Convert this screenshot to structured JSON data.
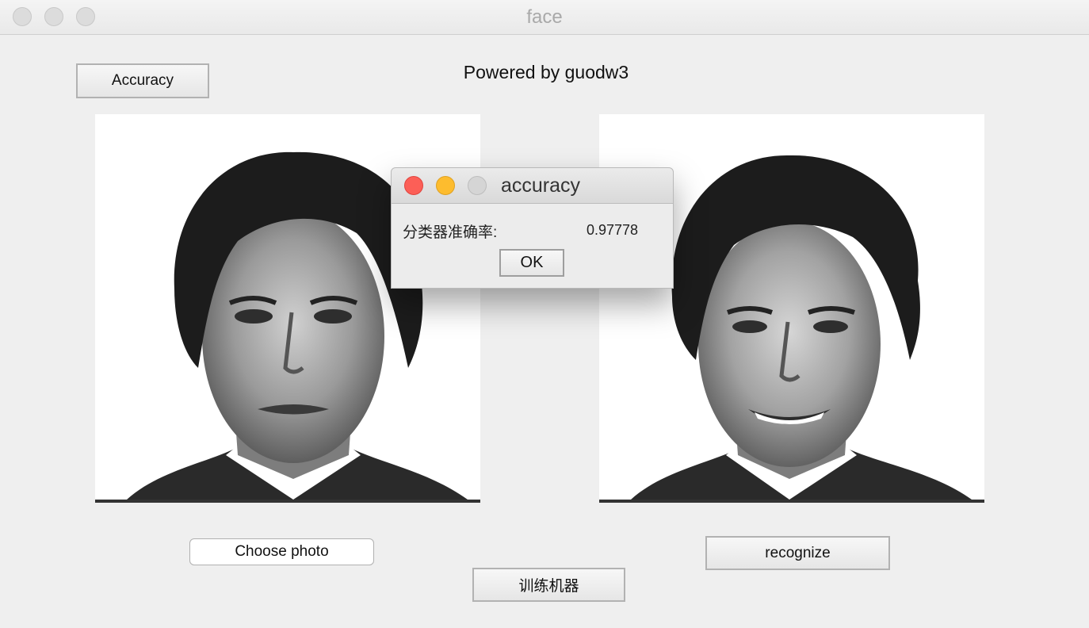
{
  "window": {
    "title": "face"
  },
  "toolbar": {
    "accuracy_label": "Accuracy"
  },
  "header": {
    "caption": "Powered by guodw3"
  },
  "buttons": {
    "choose_photo": "Choose photo",
    "recognize": "recognize",
    "train": "训练机器"
  },
  "dialog": {
    "title": "accuracy",
    "label": "分类器准确率:",
    "value": "0.97778",
    "ok_label": "OK"
  }
}
